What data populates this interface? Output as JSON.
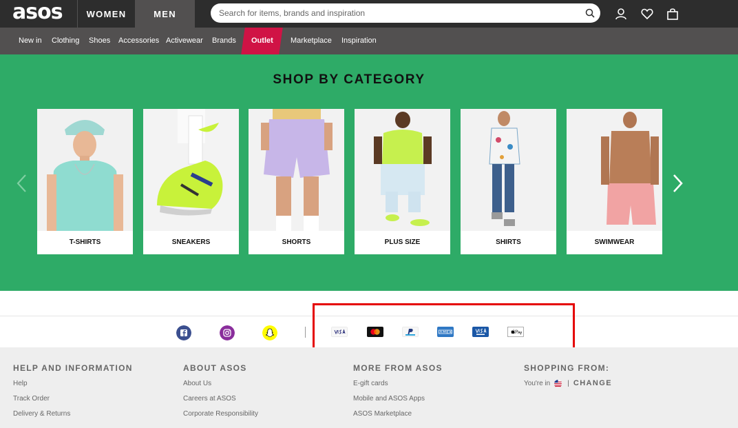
{
  "header": {
    "logo": "asos",
    "tabs": [
      "WOMEN",
      "MEN"
    ],
    "active_tab": "MEN",
    "search_placeholder": "Search for items, brands and inspiration"
  },
  "nav": {
    "items": [
      "New in",
      "Clothing",
      "Shoes",
      "Accessories",
      "Activewear",
      "Brands",
      "Outlet",
      "Marketplace",
      "Inspiration"
    ],
    "highlighted": "Outlet"
  },
  "category": {
    "title": "SHOP BY CATEGORY",
    "cards": [
      "T-SHIRTS",
      "SNEAKERS",
      "SHORTS",
      "PLUS SIZE",
      "SHIRTS",
      "SWIMWEAR"
    ]
  },
  "social_icons": [
    "facebook-icon",
    "instagram-icon",
    "snapchat-icon"
  ],
  "payment_icons": [
    "visa-icon",
    "mastercard-icon",
    "paypal-icon",
    "american-express-icon",
    "visa-electron-icon",
    "apple-pay-icon"
  ],
  "footer": {
    "help": {
      "heading": "HELP AND INFORMATION",
      "links": [
        "Help",
        "Track Order",
        "Delivery & Returns"
      ]
    },
    "about": {
      "heading": "ABOUT ASOS",
      "links": [
        "About Us",
        "Careers at ASOS",
        "Corporate Responsibility"
      ]
    },
    "more": {
      "heading": "MORE FROM ASOS",
      "links": [
        "E-gift cards",
        "Mobile and ASOS Apps",
        "ASOS Marketplace"
      ]
    },
    "shopping": {
      "heading": "SHOPPING FROM:",
      "location_text": "You're in",
      "separator": "|",
      "change_label": "CHANGE"
    }
  },
  "colors": {
    "topbar": "#2d2d2d",
    "navbar": "#525050",
    "outlet": "#d01345",
    "category_bg": "#2eab67",
    "footer_bg": "#eeeeee",
    "highlight": "#e50000"
  }
}
